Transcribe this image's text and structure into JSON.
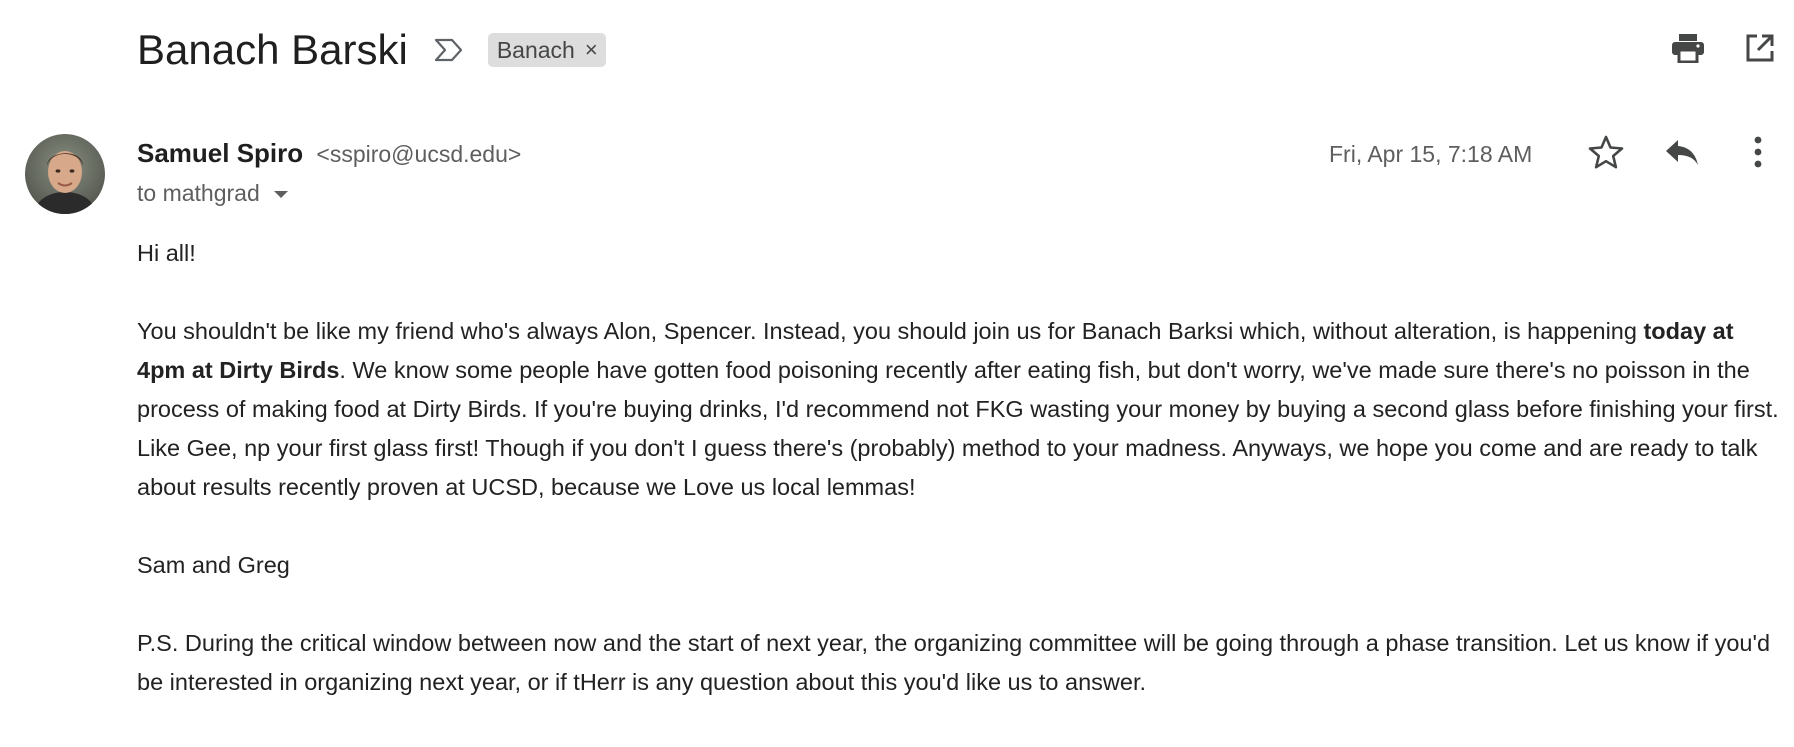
{
  "email": {
    "subject": "Banach Barski",
    "label": "Banach",
    "label_remove": "×",
    "sender_name": "Samuel Spiro",
    "sender_email": "<sspiro@ucsd.edu>",
    "recipient_line": "to mathgrad",
    "date": "Fri, Apr 15, 7:18 AM",
    "body": {
      "greeting": "Hi all!",
      "p1_before_bold": "You shouldn't be like my friend who's always Alon, Spencer.  Instead, you should join us for Banach Barksi which, without alteration, is happening ",
      "p1_bold": "today at 4pm at Dirty Birds",
      "p1_after_bold": ".  We know some people have gotten food poisoning recently after eating fish, but don't worry, we've made sure there's no poisson in the process of making food at Dirty Birds.  If you're buying drinks, I'd recommend not FKG wasting your money by buying a second glass before finishing your first.  Like Gee, np your first glass first!  Though if you don't I guess there's (probably) method to your madness.  Anyways, we hope you come and are ready to talk about results recently proven at UCSD, because we Love us local lemmas!",
      "signature": "Sam and Greg",
      "postscript": "P.S. During the critical window between now and the start of next year, the organizing committee will be going through a phase transition.  Let us know if you'd be interested in organizing next year, or if tHerr is any question about this you'd like us to answer."
    }
  },
  "icons": {
    "importance": "important-marker-icon",
    "print": "print-icon",
    "new_window": "open-in-new-window-icon",
    "star": "star-icon",
    "reply": "reply-icon",
    "more": "more-vert-icon"
  },
  "colors": {
    "text": "#202124",
    "secondary_text": "#5e5e5e",
    "label_chip_bg": "#dddddd",
    "icon": "#444746"
  }
}
